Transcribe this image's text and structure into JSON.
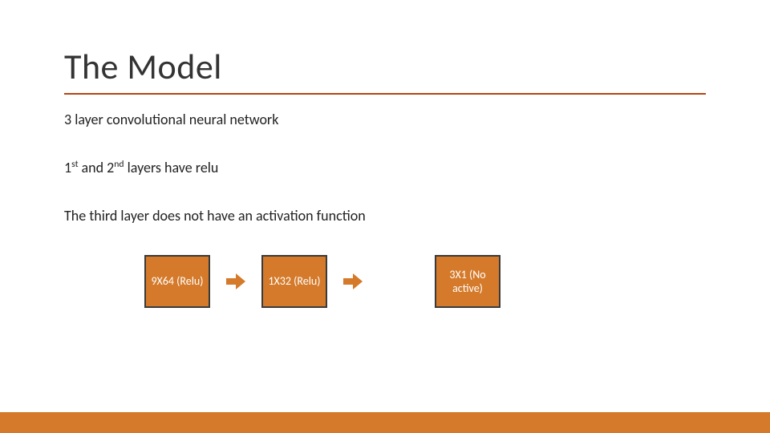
{
  "title": "The Model",
  "body": {
    "line1": "3 layer convolutional neural network",
    "line2_pre1": "1",
    "line2_sup1": "st",
    "line2_mid": " and 2",
    "line2_sup2": "nd",
    "line2_post": " layers have relu",
    "line3": "The third layer does not have an activation function"
  },
  "boxes": [
    {
      "label": "9X64 (Relu)"
    },
    {
      "label": "1X32 (Relu)"
    },
    {
      "label": "3X1 (No active)"
    }
  ],
  "colors": {
    "accent": "#d47a2a",
    "underline": "#b24417"
  }
}
